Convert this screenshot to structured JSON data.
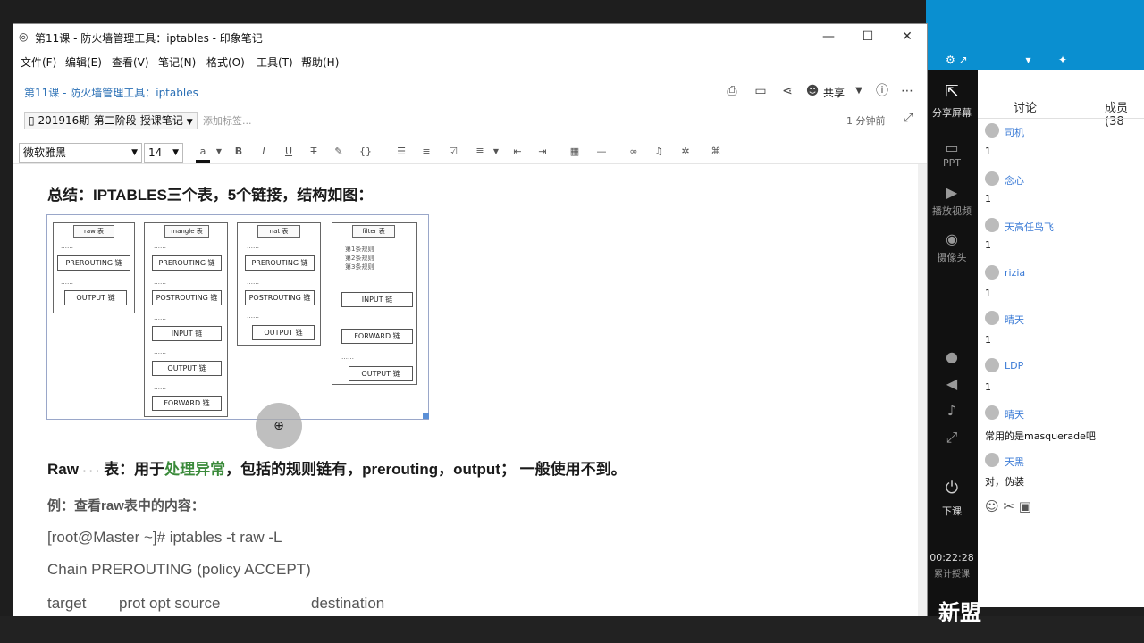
{
  "window": {
    "title": "第11课 - 防火墙管理工具：iptables - 印象笔记",
    "controls": {
      "min": "—",
      "max": "☐",
      "close": "✕"
    }
  },
  "menu": [
    "文件(F)",
    "编辑(E)",
    "查看(V)",
    "笔记(N)",
    "格式(O)",
    "工具(T)",
    "帮助(H)"
  ],
  "note": {
    "title": "第11课 - 防火墙管理工具：iptables",
    "share": "共享",
    "notebook": "201916期-第二阶段-授课笔记",
    "add_tag": "添加标签...",
    "modified": "1 分钟前"
  },
  "format": {
    "font": "微软雅黑",
    "size": "14"
  },
  "content": {
    "summary": "总结：IPTABLES三个表，5个链接，结构如图：",
    "raw_line_prefix": "Raw",
    "raw_line_table": "表：用于",
    "raw_line_highlight": "处理异常",
    "raw_line_rest": "，包括的规则链有，prerouting，output； 一般使用不到。",
    "example": "例：查看raw表中的内容：",
    "cmd": "[root@Master ~]# iptables -t raw -L",
    "chain": "Chain PREROUTING (policy ACCEPT)",
    "hdr_target": "target",
    "hdr_prot": "prot opt source",
    "hdr_dest": "destination"
  },
  "diagram": {
    "tables": [
      {
        "name": "raw 表",
        "chains": [
          "PREROUTING 链",
          "OUTPUT 链"
        ]
      },
      {
        "name": "mangle 表",
        "chains": [
          "PREROUTING 链",
          "POSTROUTING 链",
          "INPUT 链",
          "OUTPUT 链",
          "FORWARD 链"
        ]
      },
      {
        "name": "nat 表",
        "chains": [
          "PREROUTING 链",
          "POSTROUTING 链",
          "OUTPUT 链"
        ]
      },
      {
        "name": "filter 表",
        "rules": [
          "第1条规则",
          "第2条规则",
          "第3条规则"
        ],
        "chains": [
          "INPUT 链",
          "FORWARD 链",
          "OUTPUT 链"
        ]
      }
    ]
  },
  "panel": {
    "share_screen": "分享屏幕",
    "tab_discuss": "讨论",
    "tab_members": "成员(38",
    "side": [
      "PPT",
      "播放视频",
      "摄像头",
      "下课"
    ],
    "timer": "00:22:28",
    "timer_label": "累计授课",
    "messages": [
      {
        "name": "司机",
        "text": "1"
      },
      {
        "name": "念心",
        "text": "1"
      },
      {
        "name": "天高任鸟飞",
        "text": "1"
      },
      {
        "name": "rizia",
        "text": "1"
      },
      {
        "name": "晴天",
        "text": "1"
      },
      {
        "name": "LDP",
        "text": "1"
      },
      {
        "name": "晴天",
        "text": "常用的是masquerade吧"
      },
      {
        "name": "天黑",
        "text": "对，伪装"
      }
    ]
  },
  "watermark": "新盟"
}
